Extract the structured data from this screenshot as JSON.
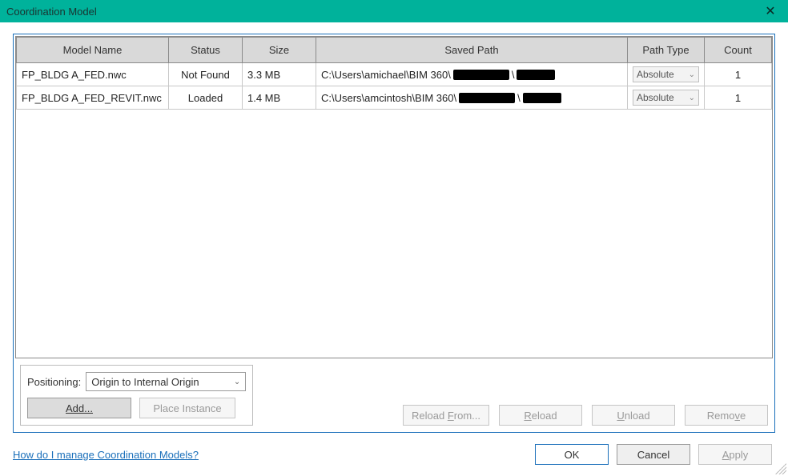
{
  "window": {
    "title": "Coordination Model",
    "close_glyph": "✕"
  },
  "table": {
    "headers": {
      "name": "Model Name",
      "status": "Status",
      "size": "Size",
      "path": "Saved Path",
      "ptype": "Path Type",
      "count": "Count"
    },
    "rows": [
      {
        "name": "FP_BLDG A_FED.nwc",
        "status": "Not Found",
        "size": "3.3 MB",
        "path_prefix": "C:\\Users\\amichael\\BIM 360\\",
        "ptype": "Absolute",
        "count": "1"
      },
      {
        "name": "FP_BLDG A_FED_REVIT.nwc",
        "status": "Loaded",
        "size": "1.4 MB",
        "path_prefix": "C:\\Users\\amcintosh\\BIM 360\\",
        "ptype": "Absolute",
        "count": "1"
      }
    ]
  },
  "positioning": {
    "label": "Positioning:",
    "value": "Origin to Internal Origin"
  },
  "buttons": {
    "add": "Add...",
    "place_instance": "Place Instance",
    "reload_from_pre": "Reload ",
    "reload_from_u": "F",
    "reload_from_post": "rom...",
    "reload_u": "R",
    "reload_post": "eload",
    "unload_u": "U",
    "unload_post": "nload",
    "remove_pre": "Remo",
    "remove_u": "v",
    "remove_post": "e",
    "ok": "OK",
    "cancel": "Cancel",
    "apply_u": "A",
    "apply_post": "pply"
  },
  "help_link": "How do I manage Coordination Models?",
  "chevron": "⌄",
  "path_sep": "\\"
}
